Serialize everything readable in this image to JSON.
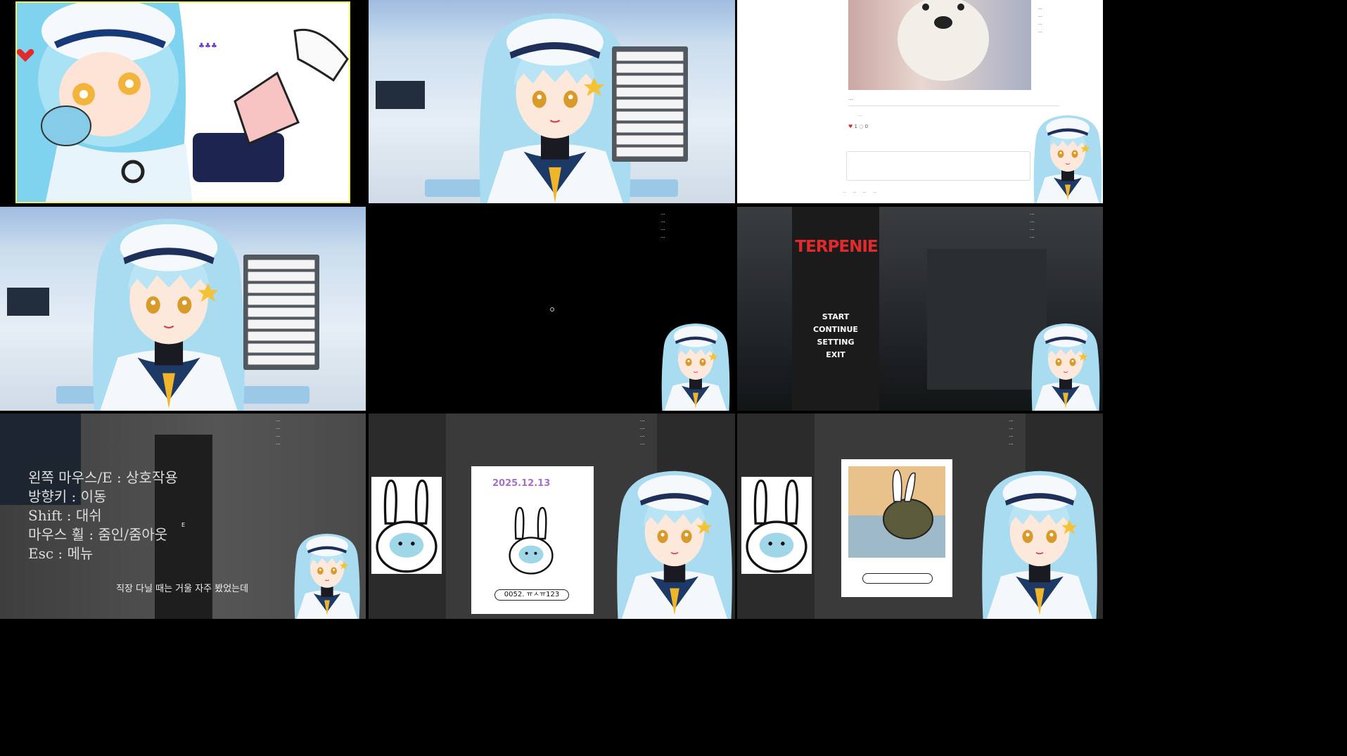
{
  "panels": {
    "p1": {
      "name": "illustration-panel",
      "deco_text": "♣♣♣"
    },
    "p2": {
      "name": "vtuber-room-panel-top",
      "sidebar_lines": [
        "...",
        "...",
        "..."
      ],
      "chat_items": [
        "",
        "",
        "",
        "",
        "",
        "",
        "",
        "",
        "",
        "",
        "",
        "",
        ""
      ]
    },
    "p3": {
      "name": "blog-post-panel",
      "right_notes": "...\n...\n...\n...",
      "caption": "...",
      "comment_user": "...",
      "like_count": "1",
      "comment_count": "0",
      "footer_buttons": [
        "...",
        "...",
        "...",
        "..."
      ]
    },
    "p4": {
      "name": "vtuber-room-panel-bottom",
      "chat_items": [
        "",
        "",
        "",
        "",
        "",
        "",
        "",
        "",
        "",
        "",
        "",
        "",
        ""
      ]
    },
    "p5": {
      "name": "black-screen-panel",
      "notes": "...\n...\n...\n..."
    },
    "p6": {
      "name": "game-title-panel",
      "title": "TERPENIE",
      "menu": [
        "START",
        "CONTINUE",
        "SETTING",
        "EXIT"
      ],
      "notes": "...\n...\n...\n..."
    },
    "p7": {
      "name": "game-controls-panel",
      "controls": "왼쪽 마우스/E : 상호작용\n방향키 : 이동\nShift : 대쉬\n마우스 휠 : 줌인/줌아웃\nEsc : 메뉴",
      "notes": "...\n...\n...\n...",
      "interact_key": "E",
      "subtitle": "직장 다닐 때는 거울 자주 봤었는데"
    },
    "p8": {
      "name": "drawing-panel-left",
      "notes": "...\n...\n...\n...",
      "stamp_text": "2025.12.13",
      "tag": "0052. ㅠㅅㅠ123"
    },
    "p9": {
      "name": "drawing-panel-right",
      "notes": "...\n...\n...\n..."
    }
  },
  "colors": {
    "hair": "#a9dcf0",
    "uniform": "#1d3a66",
    "accent": "#e22a2a"
  }
}
